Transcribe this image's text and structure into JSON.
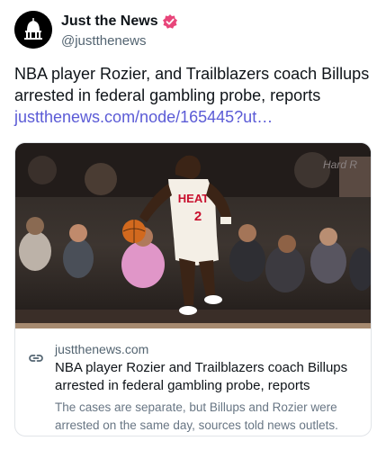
{
  "account": {
    "display_name": "Just the News",
    "handle": "@justthenews",
    "verified_color": "#e8457a"
  },
  "post": {
    "text": "NBA player Rozier, and Trailblazers coach Billups arrested in federal gambling probe, reports ",
    "link_text": "justthenews.com/node/165445?ut…"
  },
  "card": {
    "image_jersey": "HEAT",
    "image_number": "2",
    "domain": "justthenews.com",
    "title": "NBA player Rozier and Trailblazers coach Billups arrested in federal gambling probe, reports",
    "description": "The cases are separate, but Billups and Rozier were arrested on the same day, sources told news outlets."
  },
  "colors": {
    "link": "#5b5bd6",
    "muted": "#536471"
  }
}
